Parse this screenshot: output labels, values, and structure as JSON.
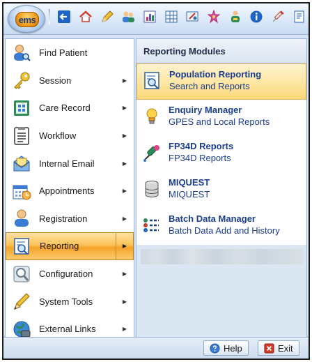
{
  "orb": {
    "label": "ems"
  },
  "quick_access": [
    {
      "name": "back-arrow-icon",
      "color": "#1e63c6"
    },
    {
      "name": "home-icon",
      "color": "#d23a2a"
    },
    {
      "name": "pencil-icon",
      "color": "#e3b21a"
    },
    {
      "name": "users-icon",
      "color": "#3a7bd5"
    },
    {
      "name": "chart-icon",
      "color": "#5a5aa8"
    },
    {
      "name": "grid-icon",
      "color": "#3a6ea8"
    },
    {
      "name": "tools-icon",
      "color": "#3a6ea8"
    },
    {
      "name": "star-icon",
      "color": "#c82b8a"
    },
    {
      "name": "person-tree-icon",
      "color": "#2e8b57"
    },
    {
      "name": "info-icon",
      "color": "#1e63c6"
    },
    {
      "name": "syringe-icon",
      "color": "#c23a2a"
    },
    {
      "name": "report-icon",
      "color": "#1e63c6"
    }
  ],
  "menu": [
    {
      "key": "find-patient",
      "label": "Find Patient",
      "arrow": false,
      "icon": "person-search-icon"
    },
    {
      "key": "session",
      "label": "Session",
      "arrow": true,
      "icon": "key-icon"
    },
    {
      "key": "care-record",
      "label": "Care Record",
      "arrow": true,
      "icon": "care-record-icon"
    },
    {
      "key": "workflow",
      "label": "Workflow",
      "arrow": true,
      "icon": "workflow-icon"
    },
    {
      "key": "internal-email",
      "label": "Internal Email",
      "arrow": true,
      "icon": "email-icon"
    },
    {
      "key": "appointments",
      "label": "Appointments",
      "arrow": true,
      "icon": "calendar-icon"
    },
    {
      "key": "registration",
      "label": "Registration",
      "arrow": true,
      "icon": "registration-icon"
    },
    {
      "key": "reporting",
      "label": "Reporting",
      "arrow": true,
      "icon": "reporting-icon",
      "active": true
    },
    {
      "key": "configuration",
      "label": "Configuration",
      "arrow": true,
      "icon": "configuration-icon"
    },
    {
      "key": "system-tools",
      "label": "System Tools",
      "arrow": true,
      "icon": "tools-icon"
    },
    {
      "key": "external-links",
      "label": "External Links",
      "arrow": true,
      "icon": "globe-icon"
    }
  ],
  "reporting_panel": {
    "header": "Reporting Modules",
    "items": [
      {
        "title": "Population Reporting",
        "subtitle": "Search and Reports",
        "icon": "population-reporting-icon",
        "highlight": true
      },
      {
        "title": "Enquiry Manager",
        "subtitle": "GPES and Local Reports",
        "icon": "lightbulb-icon"
      },
      {
        "title": "FP34D Reports",
        "subtitle": "FP34D Reports",
        "icon": "dropper-icon"
      },
      {
        "title": "MIQUEST",
        "subtitle": "MIQUEST",
        "icon": "database-icon"
      },
      {
        "title": "Batch Data Manager",
        "subtitle": "Batch Data Add and History",
        "icon": "batch-list-icon"
      }
    ]
  },
  "footer": {
    "help_label": "Help",
    "exit_label": "Exit"
  },
  "colors": {
    "active_menu": "#f6a229",
    "link_text": "#1a3d8f",
    "accent_blue": "#9fb7d6"
  }
}
